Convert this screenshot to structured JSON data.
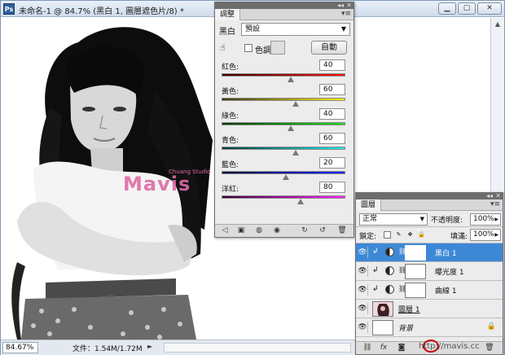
{
  "window": {
    "title": "未命名-1 @ 84.7% (黑白 1, 圖層遮色片/8) *",
    "app_logo": "Ps",
    "buttons": [
      "minimize-icon",
      "maximize-icon",
      "close-icon"
    ]
  },
  "status": {
    "zoom": "84.67%",
    "doc_info": "文件：1.54M/1.72M",
    "arrow": "►"
  },
  "photo": {
    "watermark": "Mavis",
    "watermark_small": "Chuang Studio"
  },
  "adjustments": {
    "tab": "調整",
    "type_label": "黑白",
    "preset": "預設",
    "tint_label": "色調",
    "tint_checked": false,
    "auto_label": "自動",
    "sliders": [
      {
        "label": "紅色:",
        "value": "40",
        "colors": [
          "#3a0000",
          "#ff1010"
        ],
        "pos": 0.56
      },
      {
        "label": "黃色:",
        "value": "60",
        "colors": [
          "#3a3a00",
          "#ffee00"
        ],
        "pos": 0.6
      },
      {
        "label": "綠色:",
        "value": "40",
        "colors": [
          "#003a00",
          "#20e020"
        ],
        "pos": 0.56
      },
      {
        "label": "青色:",
        "value": "60",
        "colors": [
          "#003a3a",
          "#20e8e8"
        ],
        "pos": 0.6
      },
      {
        "label": "藍色:",
        "value": "20",
        "colors": [
          "#00003a",
          "#1e28ff"
        ],
        "pos": 0.52
      },
      {
        "label": "洋紅:",
        "value": "80",
        "colors": [
          "#3a003a",
          "#ff20ff"
        ],
        "pos": 0.64
      }
    ],
    "footer_icons": [
      "back-icon",
      "panel-icon",
      "clip-icon",
      "visibility-icon",
      "previous-state-icon",
      "reset-icon",
      "delete-icon"
    ]
  },
  "layers": {
    "tab": "圖層",
    "blend_mode": "正常",
    "opacity_label": "不透明度:",
    "opacity_value": "100%",
    "lock_label": "鎖定:",
    "fill_label": "填滿:",
    "fill_value": "100%",
    "items": [
      {
        "name": "黑白 1",
        "selected": true
      },
      {
        "name": "曝光度 1",
        "selected": false
      },
      {
        "name": "曲線 1",
        "selected": false
      },
      {
        "name": "圖層 1",
        "selected": false
      },
      {
        "name": "背景",
        "selected": false
      }
    ],
    "footer_url": "http://mavis.cc"
  },
  "colors": {
    "selection": "#3d88d6",
    "watermark": "#e06aa6",
    "highlight_circle": "#cc0000"
  }
}
